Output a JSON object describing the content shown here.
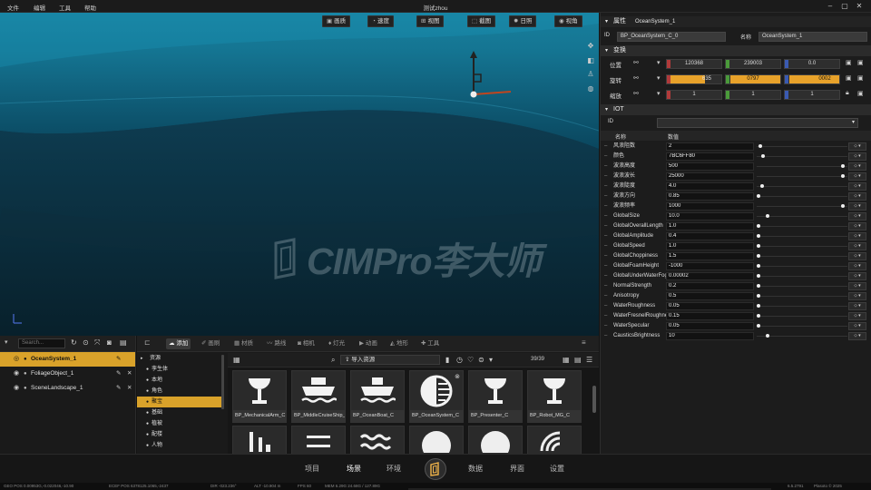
{
  "window": {
    "title": "测试zhou",
    "menu": [
      "文件",
      "编辑",
      "工具",
      "帮助"
    ]
  },
  "viewport": {
    "toolbar": [
      {
        "icon": "image-icon",
        "label": "画质"
      },
      {
        "icon": "speed-icon",
        "label": "速度"
      },
      {
        "icon": "view-icon",
        "label": "视图"
      },
      {
        "icon": "screenshot-icon",
        "label": "截图"
      },
      {
        "icon": "sun-icon",
        "label": "日照"
      },
      {
        "icon": "eye-icon",
        "label": "视角"
      }
    ],
    "watermark": "CIMPro李大师"
  },
  "outliner": {
    "search_placeholder": "Search...",
    "items": [
      {
        "name": "OceanSystem_1",
        "selected": true
      },
      {
        "name": "FoliageObject_1",
        "selected": false
      },
      {
        "name": "SceneLandscape_1",
        "selected": false
      }
    ]
  },
  "content_browser": {
    "tabs": [
      "添加",
      "画刷",
      "材质",
      "路线",
      "相机",
      "灯光",
      "动画",
      "地形",
      "工具"
    ],
    "active_tab": "添加",
    "categories": [
      {
        "label": "资源",
        "root": true
      },
      {
        "label": "孪生体"
      },
      {
        "label": "本地"
      },
      {
        "label": "角色"
      },
      {
        "label": "聚宝",
        "selected": true
      },
      {
        "label": "基础"
      },
      {
        "label": "植被"
      },
      {
        "label": "配楼"
      },
      {
        "label": "人物"
      }
    ],
    "import_label": "导入资源",
    "page_count": "39/39",
    "assets": [
      {
        "name": "BP_MechanicalArm_C",
        "icon": "arm-icon"
      },
      {
        "name": "BP_MiddleCruiseShip_C",
        "icon": "ship-icon"
      },
      {
        "name": "BP_OceanBoat_C",
        "icon": "boat-icon"
      },
      {
        "name": "BP_OceanSystem_C",
        "icon": "ocean-icon"
      },
      {
        "name": "BP_Presenter_C",
        "icon": "presenter-icon"
      },
      {
        "name": "BP_Robot_MG_C",
        "icon": "robot-icon"
      }
    ]
  },
  "properties": {
    "header": "属性",
    "object_name": "OceanSystem_1",
    "id_label": "ID",
    "id_value": "BP_OceanSystem_C_0",
    "name_label": "名称",
    "name_value": "OceanSystem_1",
    "transform": {
      "title": "变换",
      "rows": [
        {
          "label": "位置",
          "x": "120368",
          "y": "239003",
          "z": "0.0"
        },
        {
          "label": "旋转",
          "x": "635",
          "y": "0797",
          "z": "0002"
        },
        {
          "label": "缩放",
          "x": "1",
          "y": "1",
          "z": "1"
        }
      ]
    },
    "iot": {
      "title": "IOT",
      "id_label": "ID",
      "col_name": "名称",
      "col_value": "数值",
      "rows": [
        {
          "name": "风浪阻数",
          "value": "2",
          "level": 0.02
        },
        {
          "name": "颜色",
          "value": "7BC6FF80",
          "level": 0.05
        },
        {
          "name": "波浪高度",
          "value": "500",
          "level": 0.97
        },
        {
          "name": "波浪波长",
          "value": "25000",
          "level": 0.97
        },
        {
          "name": "波浪陡度",
          "value": "4.0",
          "level": 0.04
        },
        {
          "name": "波浪方向",
          "value": "0.85",
          "level": 0.0
        },
        {
          "name": "波浪频率",
          "value": "1000",
          "level": 0.97
        },
        {
          "name": "GlobalSize",
          "value": "10.0",
          "level": 0.1
        },
        {
          "name": "GlobalOverallLength",
          "value": "1.0",
          "level": 0.0
        },
        {
          "name": "GlobalAmplitude",
          "value": "0.4",
          "level": 0.0
        },
        {
          "name": "GlobalSpeed",
          "value": "1.0",
          "level": 0.0
        },
        {
          "name": "GlobalChoppiness",
          "value": "1.5",
          "level": 0.0
        },
        {
          "name": "GlobalFoamHeight",
          "value": "-1000",
          "level": 0.0
        },
        {
          "name": "GlobalUnderWaterFog",
          "value": "0.00002",
          "level": 0.0
        },
        {
          "name": "NormalStrength",
          "value": "0.2",
          "level": 0.0
        },
        {
          "name": "Anisotropy",
          "value": "0.5",
          "level": 0.0
        },
        {
          "name": "WaterRoughness",
          "value": "0.05",
          "level": 0.0
        },
        {
          "name": "WaterFresnelRoughness",
          "value": "0.15",
          "level": 0.0
        },
        {
          "name": "WaterSpecular",
          "value": "0.05",
          "level": 0.0
        },
        {
          "name": "CausticsBrightness",
          "value": "10",
          "level": 0.1
        }
      ]
    }
  },
  "bottom_nav": {
    "items": [
      "项目",
      "场景",
      "环境",
      "数据",
      "界面",
      "设置"
    ],
    "active": "场景"
  },
  "status_bar": {
    "geo_pos": "GEO POS 0.00953G,-0.022046,-10.90",
    "ecef_pos": "ECEF POS 6378125.1065,-2437",
    "dir": "DIR -023.236°",
    "alt": "ALT -10.904 m",
    "fps": "FPS 60",
    "mem": "MEM 6.29G 24.68G / 127.89G",
    "version": "6.5.2791",
    "copyright": "Plasoto © 2025"
  },
  "colors": {
    "accent": "#d9a22a",
    "panel": "#1c1c1c",
    "water_top": "#0f5a78",
    "water_bottom": "#081d27"
  }
}
